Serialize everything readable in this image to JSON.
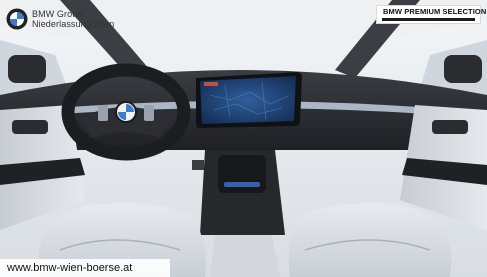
{
  "dealer": {
    "line1": "BMW Group",
    "line2": "Niederlassung Wien"
  },
  "badge": {
    "title": "BMW PREMIUM SELECTION"
  },
  "footer": {
    "url": "www.bmw-wien-boerse.at"
  },
  "colors": {
    "upholstery": "#dde1e6",
    "dashboard": "#2b2e33",
    "ambient_light": "#b9c6d6",
    "screen": "#1d3f73",
    "steering_wheel": "#1c1d20",
    "console_glow": "#3a6fd0"
  },
  "icons": [
    "bmw-roundel-icon"
  ]
}
